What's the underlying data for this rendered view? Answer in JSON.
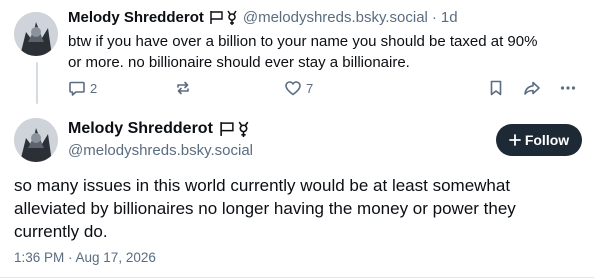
{
  "parent_post": {
    "author_name": "Melody Shredderot",
    "handle": "@melodyshreds.bsky.social",
    "separator": "·",
    "time_ago": "1d",
    "text_line1": "btw if you have over a billion to your name you should be taxed at 90%",
    "text_line2": "or more. no billionaire should ever stay a billionaire.",
    "reply_count": "2",
    "repost_count": "",
    "like_count": "7"
  },
  "main_post": {
    "author_name": "Melody Shredderot",
    "handle": "@melodyshreds.bsky.social",
    "follow_label": "Follow",
    "text_line1": "so many issues in this world currently would be at least somewhat",
    "text_line2": "alleviated by billionaires no longer having the money or power they",
    "text_line3": "currently do.",
    "timestamp": "1:36 PM · Aug 17, 2026"
  },
  "icons": {
    "flags": [
      "pride-flag-icon",
      "trans-symbol-icon"
    ],
    "actions": [
      "reply-icon",
      "repost-icon",
      "like-icon",
      "bookmark-icon",
      "share-icon",
      "more-icon"
    ]
  },
  "colors": {
    "text": "#0b0f14",
    "muted": "#5a6d80",
    "follow_bg": "#1e2936",
    "thread_line": "#d4dbe2"
  }
}
